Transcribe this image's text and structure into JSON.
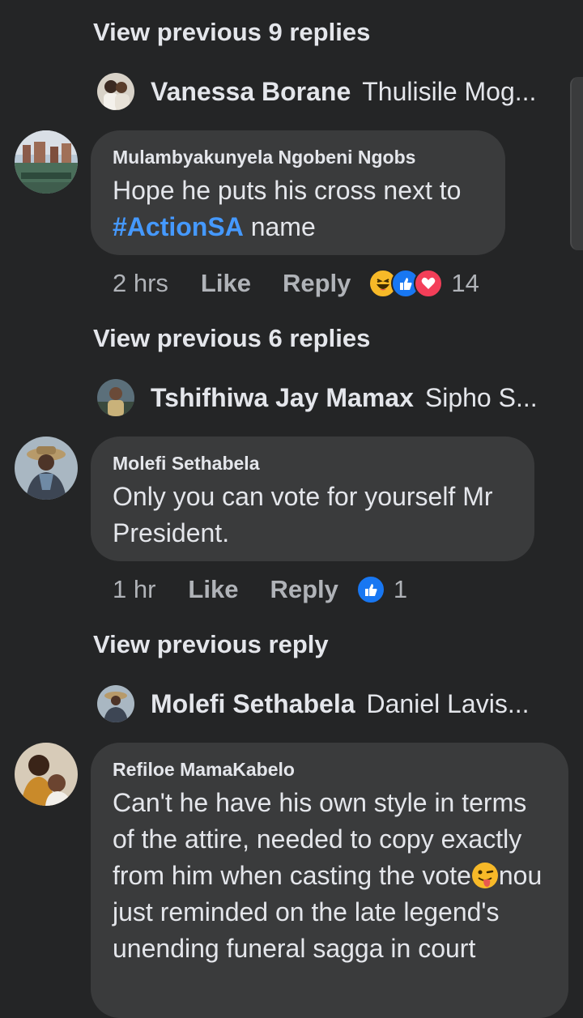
{
  "threads": [
    {
      "view_previous": "View previous 9 replies",
      "collapsed_reply": {
        "name": "Vanessa Borane",
        "snippet": "Thulisile Mog..."
      },
      "comment": {
        "author": "Mulambyakunyela Ngobeni Ngobs",
        "text_before": "Hope he puts his cross next to",
        "hashtag": "#ActionSA",
        "text_after": " name",
        "time": "2 hrs",
        "like_label": "Like",
        "reply_label": "Reply",
        "reactions": [
          "haha-icon",
          "like-icon",
          "love-icon"
        ],
        "reaction_count": "14"
      }
    },
    {
      "view_previous": "View previous 6 replies",
      "collapsed_reply": {
        "name": "Tshifhiwa Jay Mamax",
        "snippet": "Sipho S..."
      },
      "comment": {
        "author": "Molefi Sethabela",
        "text": "Only you can vote for yourself Mr President.",
        "time": "1 hr",
        "like_label": "Like",
        "reply_label": "Reply",
        "reactions": [
          "like-icon"
        ],
        "reaction_count": "1"
      }
    },
    {
      "view_previous": "View previous reply",
      "collapsed_reply": {
        "name": "Molefi Sethabela",
        "snippet": "Daniel Lavis..."
      },
      "comment": {
        "author": "Refiloe MamaKabelo",
        "text_before": "Can't he have his own style in terms of the attire, needed to copy exactly from him when casting the vote",
        "emoji": "winking-tongue-emoji",
        "text_after": "nou just reminded on the late legend's unending funeral sagga in court"
      }
    }
  ],
  "colors": {
    "background": "#242526",
    "bubble": "#3a3b3c",
    "text_primary": "#e4e6eb",
    "text_secondary": "#b0b3b8",
    "hashtag": "#4599ff",
    "like_blue": "#1877f2",
    "love_red": "#f33e58",
    "haha_yellow": "#f7b928"
  }
}
